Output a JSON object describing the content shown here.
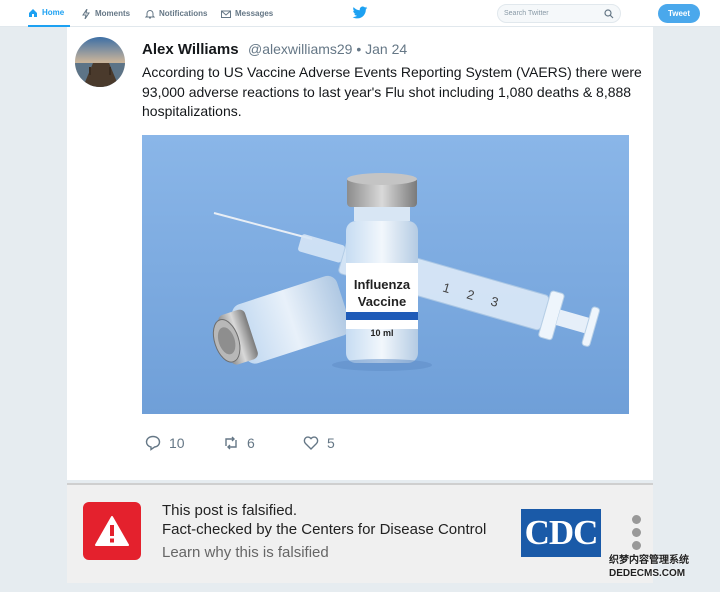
{
  "nav": {
    "home": "Home",
    "moments": "Moments",
    "notifications": "Notifications",
    "messages": "Messages",
    "search_placeholder": "Search Twitter",
    "tweet_button": "Tweet",
    "icons": [
      "home-icon",
      "moments-icon",
      "bell-icon",
      "mail-icon",
      "twitter-bird-icon",
      "search-icon"
    ]
  },
  "tweet": {
    "author_name": "Alex Williams",
    "handle_date": "@alexwilliams29 • Jan 24",
    "text": "According to US Vaccine Adverse Events Reporting System (VAERS) there were 93,000 adverse reactions to last year's Flu shot including 1,080 deaths & 8,888 hospitalizations.",
    "image": {
      "vial_label_line1": "Influenza",
      "vial_label_line2": "Vaccine",
      "vial_volume": "10 ml",
      "syringe_marks": [
        "1",
        "2",
        "3"
      ]
    },
    "actions": {
      "replies": "10",
      "retweets": "6",
      "likes": "5"
    }
  },
  "fact_check": {
    "line1": "This post is falsified.",
    "line2": "Fact-checked by the Centers for Disease Control",
    "link": "Learn why this is falsified",
    "logo_text": "CDC",
    "warning_color": "#e4212d",
    "logo_color": "#1a5aa8"
  },
  "watermark": {
    "line1": "织梦内容管理系统",
    "line2": "DEDECMS.COM"
  },
  "colors": {
    "accent": "#1da1f2",
    "background": "#e6ecf0"
  }
}
